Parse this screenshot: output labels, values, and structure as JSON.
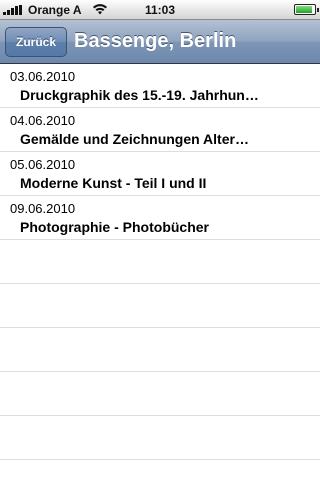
{
  "status_bar": {
    "carrier": "Orange A",
    "time": "11:03",
    "icons": [
      "signal-icon",
      "wifi-icon",
      "battery-icon"
    ],
    "battery_level": 0.9
  },
  "nav": {
    "back_label": "Zurück",
    "title": "Bassenge, Berlin"
  },
  "list": {
    "items": [
      {
        "date": "03.06.2010",
        "title": "Druckgraphik des 15.-19. Jahrhun…"
      },
      {
        "date": "04.06.2010",
        "title": "Gemälde und Zeichnungen Alter…"
      },
      {
        "date": "05.06.2010",
        "title": "Moderne Kunst - Teil I und II"
      },
      {
        "date": "09.06.2010",
        "title": "Photographie - Photobücher"
      }
    ]
  },
  "colors": {
    "navbar": "#7d96b6",
    "separator": "#dedede"
  }
}
